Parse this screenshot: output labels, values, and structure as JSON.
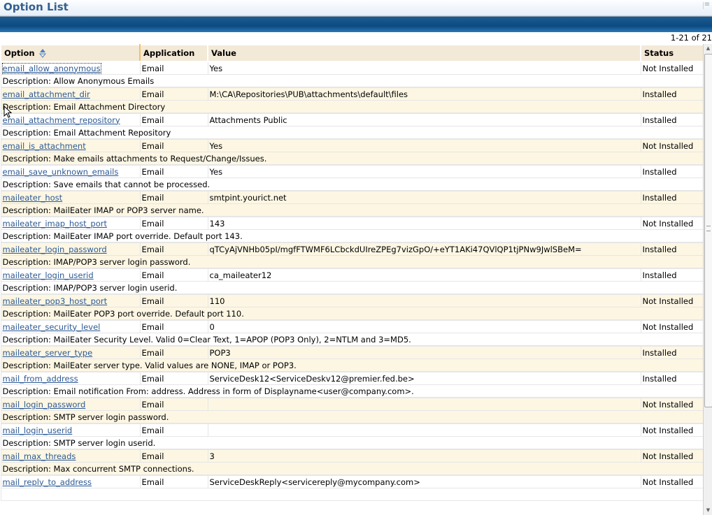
{
  "window": {
    "title": "Option List",
    "menu_icon": "menu-icon"
  },
  "pager": {
    "text": "1-21 of 21"
  },
  "columns": {
    "option": "Option",
    "application": "Application",
    "value": "Value",
    "status": "Status"
  },
  "rows": [
    {
      "option": "email_allow_anonymous",
      "application": "Email",
      "value": "Yes",
      "status": "Not Installed",
      "description": "Description: Allow Anonymous Emails"
    },
    {
      "option": "email_attachment_dir",
      "application": "Email",
      "value": "M:\\CA\\Repositories\\PUB\\attachments\\default\\files",
      "status": "Installed",
      "description": "Description: Email Attachment Directory"
    },
    {
      "option": "email_attachment_repository",
      "application": "Email",
      "value": "Attachments Public",
      "status": "Installed",
      "description": "Description: Email Attachment Repository"
    },
    {
      "option": "email_is_attachment",
      "application": "Email",
      "value": "Yes",
      "status": "Not Installed",
      "description": "Description: Make emails attachments to Request/Change/Issues."
    },
    {
      "option": "email_save_unknown_emails",
      "application": "Email",
      "value": "Yes",
      "status": "Installed",
      "description": "Description: Save emails that cannot be processed."
    },
    {
      "option": "maileater_host",
      "application": "Email",
      "value": "smtpint.yourict.net",
      "status": "Installed",
      "description": "Description: MailEater IMAP or POP3 server name."
    },
    {
      "option": "maileater_imap_host_port",
      "application": "Email",
      "value": "143",
      "status": "Not Installed",
      "description": "Description: MailEater IMAP port override. Default port 143."
    },
    {
      "option": "maileater_login_password",
      "application": "Email",
      "value": "qTCyAjVNHb05pI/mgfFTWMF6LCbckdUIreZPEg7vizGpO/+eYT1AKi47QVlQP1tjPNw9JwlSBeM=",
      "status": "Installed",
      "description": "Description: IMAP/POP3 server login password."
    },
    {
      "option": "maileater_login_userid",
      "application": "Email",
      "value": "ca_maileater12",
      "status": "Installed",
      "description": "Description: IMAP/POP3 server login userid."
    },
    {
      "option": "maileater_pop3_host_port",
      "application": "Email",
      "value": "110",
      "status": "Not Installed",
      "description": "Description: MailEater POP3 port override. Default port 110."
    },
    {
      "option": "maileater_security_level",
      "application": "Email",
      "value": "0",
      "status": "Not Installed",
      "description": "Description: MailEater Security Level. Valid 0=Clear Text, 1=APOP (POP3 Only), 2=NTLM and 3=MD5."
    },
    {
      "option": "maileater_server_type",
      "application": "Email",
      "value": "POP3",
      "status": "Installed",
      "description": "Description: MailEater server type. Valid values are NONE, IMAP or POP3."
    },
    {
      "option": "mail_from_address",
      "application": "Email",
      "value": "ServiceDesk12<ServiceDeskv12@premier.fed.be>",
      "status": "Installed",
      "description": "Description: Email notification From: address. Address in form of Displayname<user@company.com>."
    },
    {
      "option": "mail_login_password",
      "application": "Email",
      "value": "",
      "status": "Not Installed",
      "description": "Description: SMTP server login password."
    },
    {
      "option": "mail_login_userid",
      "application": "Email",
      "value": "",
      "status": "Not Installed",
      "description": "Description: SMTP server login userid."
    },
    {
      "option": "mail_max_threads",
      "application": "Email",
      "value": "3",
      "status": "Not Installed",
      "description": "Description: Max concurrent SMTP connections."
    },
    {
      "option": "mail_reply_to_address",
      "application": "Email",
      "value": "ServiceDeskReply<servicereply@mycompany.com>",
      "status": "Not Installed",
      "description": ""
    }
  ]
}
